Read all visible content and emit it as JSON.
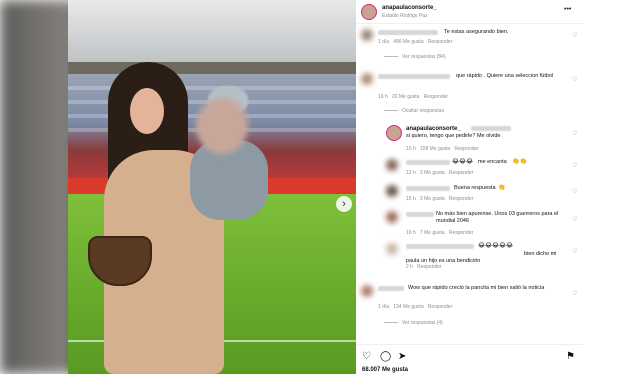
{
  "post": {
    "username": "anapaulaconsorte_",
    "location": "Estadio Rodrigo Paz",
    "more_label": "•••",
    "likes_label": "68.007 Me gusta"
  },
  "comments": [
    {
      "text": "Te estas asegurando bien.",
      "time": "1 día",
      "likes": "486 Me gusta",
      "reply": "Responder"
    },
    {
      "view_replies": "Ver respuestas (84)"
    },
    {
      "text": "que rápido . Quiere una seleccion fútbol",
      "time": "16 h",
      "likes": "20 Me gusta",
      "reply": "Responder"
    },
    {
      "hide_replies": "Ocultar respuestas"
    },
    {
      "user": "anapaulaconsorte_",
      "text": "si quiero, tengo que pedirle? Me olvide",
      "time": "15 h",
      "likes": "108 Me gusta",
      "reply": "Responder"
    },
    {
      "text": "me encanta",
      "time": "12 h",
      "likes": "2 Me gusta",
      "reply": "Responder"
    },
    {
      "text": "Buena respuesta",
      "time": "15 h",
      "likes": "3 Me gusta",
      "reply": "Responder"
    },
    {
      "text": "No más bien apurense. Unos 03 guerreros para el mundial 2046",
      "time": "16 h",
      "likes": "7 Me gusta",
      "reply": "Responder"
    },
    {
      "text": "bien dicho mi paula un hijo es una bendición",
      "time": "2 h",
      "likes": "",
      "reply": "Responder"
    },
    {
      "text": "Wow que rápido creció la pancita mi bien salió la noticia",
      "time": "1 día",
      "likes": "134 Me gusta",
      "reply": "Responder"
    },
    {
      "view_replies": "Ver respuestas (4)"
    }
  ],
  "icons": {
    "heart": "heart-icon",
    "comment": "comment-icon",
    "share": "share-icon",
    "save": "bookmark-icon",
    "next": "chevron-right-icon"
  },
  "colors": {
    "text": "#111111",
    "meta": "#8e8e8e",
    "pitch": "#6aad2d",
    "banner": "#d93a2c"
  }
}
